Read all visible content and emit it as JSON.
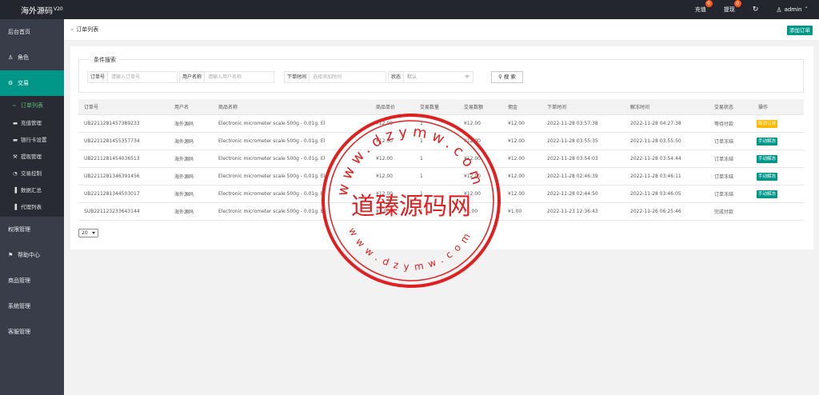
{
  "app": {
    "title": "海外源码",
    "version": "V20"
  },
  "topbar": {
    "recharge_label": "充值",
    "recharge_count": "0",
    "withdraw_label": "提现",
    "withdraw_count": "0",
    "refresh_icon": "refresh-icon",
    "user_label": "admin"
  },
  "sidebar": {
    "items": [
      {
        "label": "后台首页",
        "icon": ""
      },
      {
        "label": "角色",
        "icon": "user-icon"
      },
      {
        "label": "交易",
        "icon": "exchange-icon"
      },
      {
        "label": "权限管理",
        "icon": ""
      },
      {
        "label": "帮助中心",
        "icon": "flag-icon"
      },
      {
        "label": "商品管理",
        "icon": ""
      },
      {
        "label": "系统管理",
        "icon": ""
      },
      {
        "label": "客服管理",
        "icon": ""
      }
    ],
    "sub_items": [
      {
        "label": "订单列表",
        "icon": "cart-icon"
      },
      {
        "label": "充值管理",
        "icon": "card-icon"
      },
      {
        "label": "银行卡设置",
        "icon": "card-icon"
      },
      {
        "label": "提现管理",
        "icon": "hammer-icon"
      },
      {
        "label": "交易控制",
        "icon": "dashboard-icon"
      },
      {
        "label": "数据汇总",
        "icon": "chart-icon"
      },
      {
        "label": "代理列表",
        "icon": "chart-icon"
      }
    ]
  },
  "header": {
    "breadcrumb": "订单列表",
    "add_button": "添加订单"
  },
  "filter": {
    "legend": "条件搜索",
    "order_no_label": "订单号",
    "order_no_placeholder": "请输入订单号",
    "username_label": "用户名称",
    "username_placeholder": "请输入用户名称",
    "time_label": "下单时间",
    "time_placeholder": "选择添加时间",
    "status_label": "状态",
    "status_value": "默认",
    "search_button": "搜 索"
  },
  "table": {
    "columns": [
      "订单号",
      "用户名",
      "商品名称",
      "商品单价",
      "交易数量",
      "交易数额",
      "佣金",
      "下单时间",
      "解冻时间",
      "交易状态",
      "操作"
    ],
    "rows": [
      {
        "order": "UB2211281457389233",
        "user": "海外源码",
        "product": "Electronic micrometer scale 500g - 0.01g. El",
        "price": "¥12.00",
        "qty": "1",
        "amount": "¥12.00",
        "commission": "¥12.00",
        "order_time": "2022-11-28 03:57:38",
        "unfreeze_time": "2022-11-28 04:27:38",
        "status": "等待付款",
        "action": "取消订单",
        "action_color": "orange"
      },
      {
        "order": "UB2211281455357734",
        "user": "海外源码",
        "product": "Electronic micrometer scale 500g - 0.01g. El",
        "price": "¥12.00",
        "qty": "1",
        "amount": "¥12.00",
        "commission": "¥12.00",
        "order_time": "2022-11-28 03:55:35",
        "unfreeze_time": "2022-11-28 03:55:50",
        "status": "订单冻结",
        "action": "手动解冻",
        "action_color": "green"
      },
      {
        "order": "UB2211281454036513",
        "user": "海外源码",
        "product": "Electronic micrometer scale 500g - 0.01g. El",
        "price": "¥12.00",
        "qty": "1",
        "amount": "¥12.00",
        "commission": "¥12.00",
        "order_time": "2022-11-28 03:54:03",
        "unfreeze_time": "2022-11-28 03:54:44",
        "status": "订单冻结",
        "action": "手动解冻",
        "action_color": "green"
      },
      {
        "order": "UB2211281346391456",
        "user": "海外源码",
        "product": "Electronic micrometer scale 500g - 0.01g. El",
        "price": "¥12.00",
        "qty": "1",
        "amount": "¥12.00",
        "commission": "¥12.00",
        "order_time": "2022-11-28 02:46:39",
        "unfreeze_time": "2022-11-28 03:46:11",
        "status": "订单冻结",
        "action": "手动解冻",
        "action_color": "green"
      },
      {
        "order": "UB2211281344503017",
        "user": "海外源码",
        "product": "Electronic micrometer scale 500g - 0.01g. El",
        "price": "¥12.00",
        "qty": "1",
        "amount": "¥12.00",
        "commission": "¥12.00",
        "order_time": "2022-11-28 02:44:50",
        "unfreeze_time": "2022-11-28 03:46:05",
        "status": "订单冻结",
        "action": "手动解冻",
        "action_color": "green"
      },
      {
        "order": "SUB221123233643144",
        "user": "海外源码",
        "product": "Electronic micrometer scale 500g - 0.01g. El",
        "price": "¥1.00",
        "qty": "1",
        "amount": "¥1.00",
        "commission": "¥1.00",
        "order_time": "2022-11-23 12:36:43",
        "unfreeze_time": "2022-11-26 06:25:46",
        "status": "完成付款",
        "action": "",
        "action_color": ""
      }
    ]
  },
  "pagination": {
    "page_size": "20"
  },
  "watermark": {
    "center_text": "道臻源码网",
    "ring_top": "www.dzymw.com",
    "ring_bottom": "www.dzymw.com",
    "color": "#e02020"
  }
}
